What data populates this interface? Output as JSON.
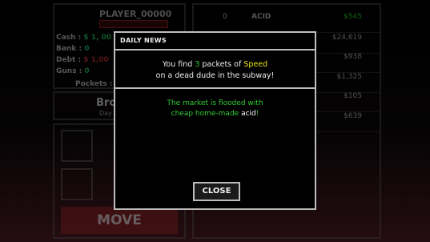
{
  "game": {
    "player_name": "PLAYER_00000",
    "stats": [
      {
        "label": "Cash :",
        "value": "$ 1, 00"
      },
      {
        "label": "Bank :",
        "value": "0"
      },
      {
        "label": "Debt :",
        "value": "$ 1,00"
      },
      {
        "label": "Guns :",
        "value": "0"
      }
    ],
    "pockets_label": "Pockets :",
    "location": "Bro",
    "day": "Day",
    "move_label": "MOVE",
    "market": [
      {
        "qty": "0",
        "name": "ACID",
        "price": "$545"
      },
      {
        "qty": "",
        "name": "",
        "price": "$24,619"
      },
      {
        "qty": "",
        "name": "",
        "price": "$938"
      },
      {
        "qty": "",
        "name": "",
        "price": "$1,325"
      },
      {
        "qty": "",
        "name": "",
        "price": "$105"
      },
      {
        "qty": "",
        "name": "",
        "price": "$639"
      }
    ]
  },
  "modal": {
    "title": "DAILY NEWS",
    "news1_pre": "You find ",
    "news1_num": "3",
    "news1_mid": " packets of ",
    "news1_drug": "Speed",
    "news1_line2": "on a dead dude in the subway!",
    "news2_line1": "The market is flooded with",
    "news2_pre": "cheap home-made ",
    "news2_drug": "acid",
    "news2_post": "!",
    "close_label": "CLOSE"
  }
}
